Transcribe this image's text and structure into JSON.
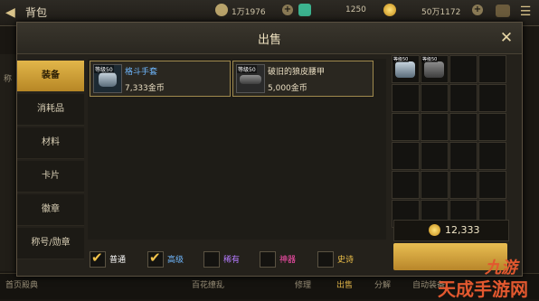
{
  "header": {
    "title": "背包",
    "currencies": [
      {
        "value": "1万1976",
        "icon": "c-coin-icon"
      },
      {
        "value": "1250",
        "icon": "gem-icon"
      },
      {
        "value": "50万1172",
        "icon": "gold-coin-icon"
      }
    ]
  },
  "modal": {
    "title": "出售",
    "close_icon": "close-icon"
  },
  "tabs": [
    {
      "label": "装备",
      "active": true
    },
    {
      "label": "消耗品",
      "active": false
    },
    {
      "label": "材料",
      "active": false
    },
    {
      "label": "卡片",
      "active": false
    },
    {
      "label": "徽章",
      "active": false
    },
    {
      "label": "称号/勋章",
      "active": false
    }
  ],
  "items": [
    {
      "level": "等级50",
      "name": "格斗手套",
      "price": "7,333金币",
      "name_color": "#6fb8ff",
      "icon": "gloves-icon"
    },
    {
      "level": "等级50",
      "name": "破旧的狼皮腰甲",
      "price": "5,000金币",
      "name_color": "#e8dcc0",
      "icon": "belt-icon"
    }
  ],
  "selected_grid": [
    {
      "level": "等级50",
      "icon": "gloves-icon"
    },
    {
      "level": "等级50",
      "icon": "belt-icon"
    }
  ],
  "total": {
    "value": "12,333",
    "icon": "gold-coin-icon"
  },
  "sell_button": {
    "label": ""
  },
  "filters": [
    {
      "label": "普通",
      "checked": true,
      "color": "#ffffff"
    },
    {
      "label": "高级",
      "checked": true,
      "color": "#6fb8ff"
    },
    {
      "label": "稀有",
      "checked": false,
      "color": "#b57bff"
    },
    {
      "label": "神器",
      "checked": false,
      "color": "#ff4fb0"
    },
    {
      "label": "史诗",
      "checked": false,
      "color": "#f0c24a"
    }
  ],
  "background": {
    "bottom_left": "首页殿典",
    "bottom_mid": "百花缭乱",
    "bottom_tabs": [
      "修理",
      "出售",
      "分解",
      "自动装备"
    ],
    "side_label": "称"
  },
  "watermark": {
    "brand": "九游",
    "text": "天成手游网"
  }
}
